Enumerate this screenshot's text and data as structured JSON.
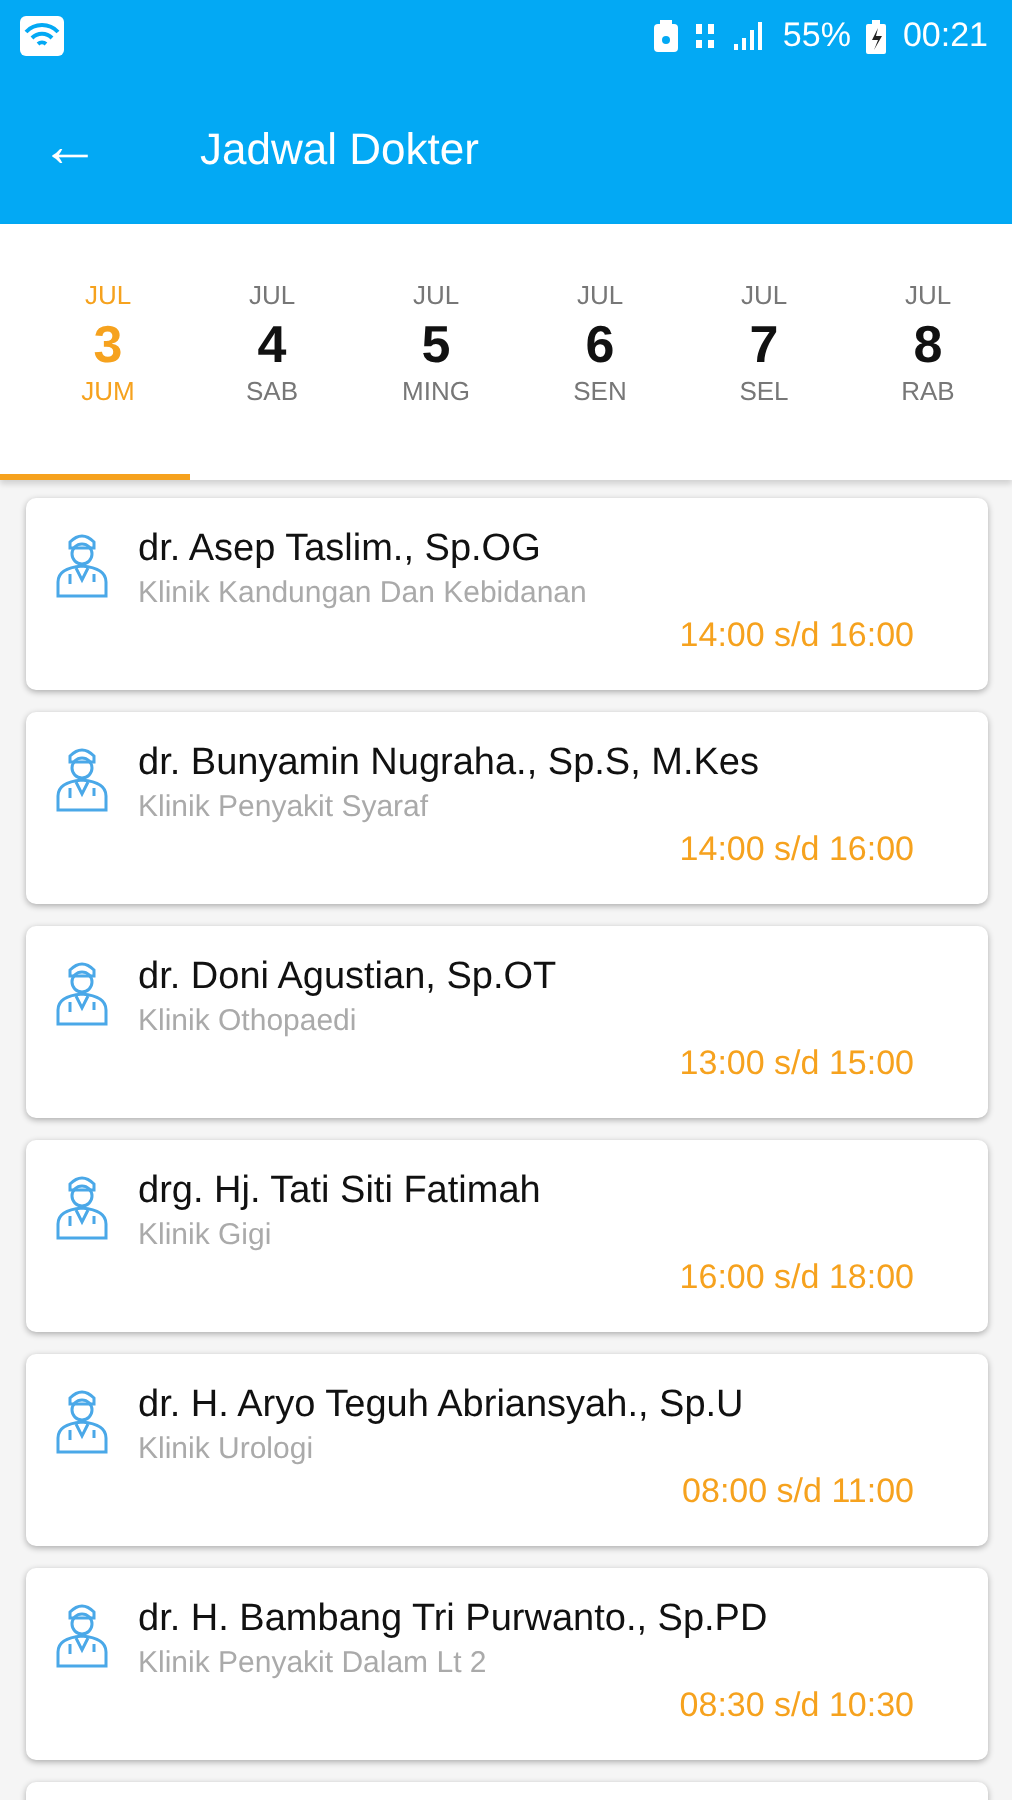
{
  "status_bar": {
    "battery": "55%",
    "time": "00:21"
  },
  "app_bar": {
    "back": "←",
    "title": "Jadwal Dokter"
  },
  "dates": [
    {
      "month": "JUL",
      "day": "3",
      "weekday": "JUM",
      "selected": true
    },
    {
      "month": "JUL",
      "day": "4",
      "weekday": "SAB",
      "selected": false
    },
    {
      "month": "JUL",
      "day": "5",
      "weekday": "MING",
      "selected": false
    },
    {
      "month": "JUL",
      "day": "6",
      "weekday": "SEN",
      "selected": false
    },
    {
      "month": "JUL",
      "day": "7",
      "weekday": "SEL",
      "selected": false
    },
    {
      "month": "JUL",
      "day": "8",
      "weekday": "RAB",
      "selected": false
    }
  ],
  "doctors": [
    {
      "name": "dr. Asep Taslim., Sp.OG",
      "clinic": "Klinik Kandungan Dan Kebidanan",
      "time": "14:00 s/d 16:00"
    },
    {
      "name": "dr. Bunyamin Nugraha., Sp.S, M.Kes",
      "clinic": "Klinik Penyakit Syaraf",
      "time": "14:00 s/d 16:00"
    },
    {
      "name": "dr. Doni Agustian, Sp.OT",
      "clinic": "Klinik Othopaedi",
      "time": "13:00 s/d 15:00"
    },
    {
      "name": "drg. Hj. Tati Siti Fatimah",
      "clinic": "Klinik Gigi",
      "time": "16:00 s/d 18:00"
    },
    {
      "name": "dr. H. Aryo Teguh Abriansyah., Sp.U",
      "clinic": "Klinik Urologi",
      "time": "08:00 s/d 11:00"
    },
    {
      "name": "dr. H. Bambang Tri Purwanto., Sp.PD",
      "clinic": "Klinik Penyakit Dalam Lt 2",
      "time": "08:30 s/d 10:30"
    }
  ]
}
